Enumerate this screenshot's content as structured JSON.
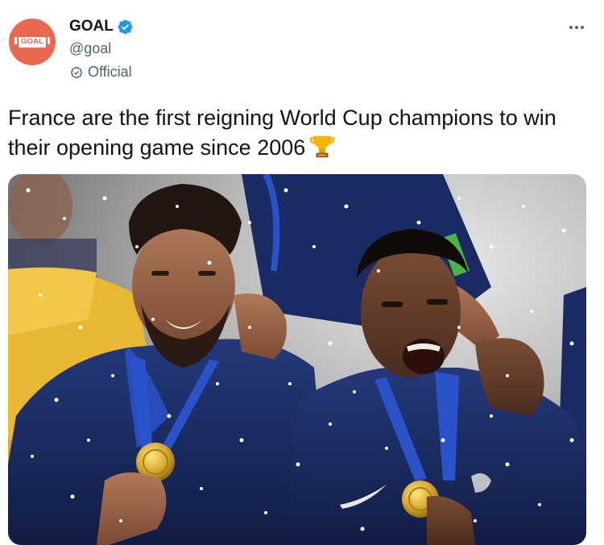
{
  "tweet": {
    "author": {
      "display_name": "GOAL",
      "handle": "@goal",
      "label": "Official",
      "avatar_text": "GOAL",
      "avatar_color": "#e8694f",
      "verified": true
    },
    "text": "France are the first reigning World Cup champions to win their opening game since 2006",
    "emoji": "trophy-icon",
    "media": {
      "type": "photo",
      "subject": "Two France players in blue kits with gold medals celebrating in the rain"
    }
  },
  "colors": {
    "verified_blue": "#1d9bf0",
    "secondary_text": "#536471",
    "primary_text": "#0f1419",
    "jersey_blue": "#1c2f6b"
  }
}
